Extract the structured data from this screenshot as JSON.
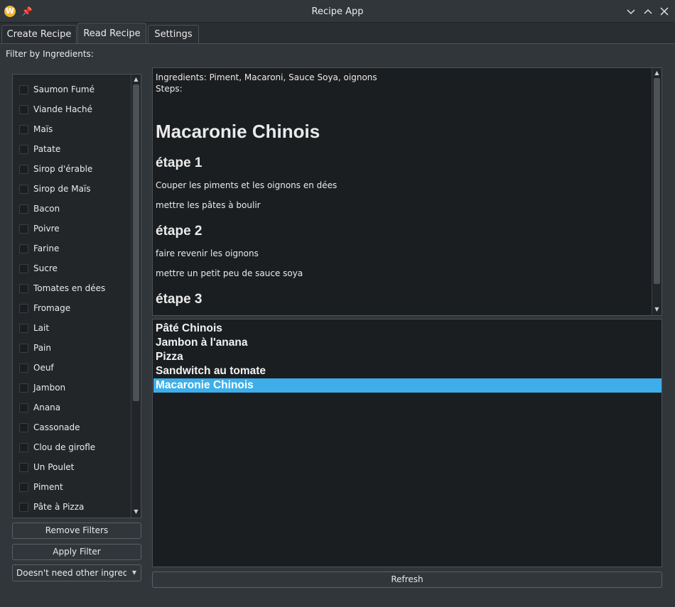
{
  "window": {
    "title": "Recipe App",
    "icon": "app-logo-icon"
  },
  "tabs": [
    {
      "label": "Create Recipe",
      "active": false
    },
    {
      "label": "Read Recipe",
      "active": true
    },
    {
      "label": "Settings",
      "active": false
    }
  ],
  "filter": {
    "label": "Filter by Ingredients:",
    "ingredients": [
      "Saumon Fumé",
      "Viande Haché",
      "Maïs",
      "Patate",
      "Sirop d'érable",
      "Sirop de Maïs",
      "Bacon",
      "Poivre",
      "Farine",
      "Sucre",
      "Tomates en dées",
      "Fromage",
      "Lait",
      "Pain",
      "Oeuf",
      "Jambon",
      "Anana",
      "Cassonade",
      "Clou de girofle",
      "Un Poulet",
      "Piment",
      "Pâte à Pizza"
    ],
    "remove_button": "Remove Filters",
    "apply_button": "Apply Filter",
    "mode_selected": "Doesn't need other ingredients"
  },
  "recipe": {
    "ingredients_line": "Ingredients: Piment, Macaroni, Sauce Soya, oignons",
    "steps_label": "Steps:",
    "title": "Macaronie Chinois",
    "steps": [
      {
        "heading": "étape 1",
        "lines": [
          "Couper les piments et les oignons en dées",
          "mettre les pâtes à boulir"
        ]
      },
      {
        "heading": "étape 2",
        "lines": [
          "faire revenir les oignons",
          "mettre un petit peu de sauce soya"
        ]
      },
      {
        "heading": "étape 3",
        "lines": []
      }
    ]
  },
  "recipe_list": {
    "items": [
      "Pâté Chinois",
      "Jambon à l'anana",
      "Pizza",
      "Sandwitch au tomate",
      "Macaronie Chinois"
    ],
    "selected_index": 4
  },
  "refresh_button": "Refresh",
  "colors": {
    "accent": "#3daee9",
    "background": "#31363b",
    "view": "#1b1e20"
  }
}
